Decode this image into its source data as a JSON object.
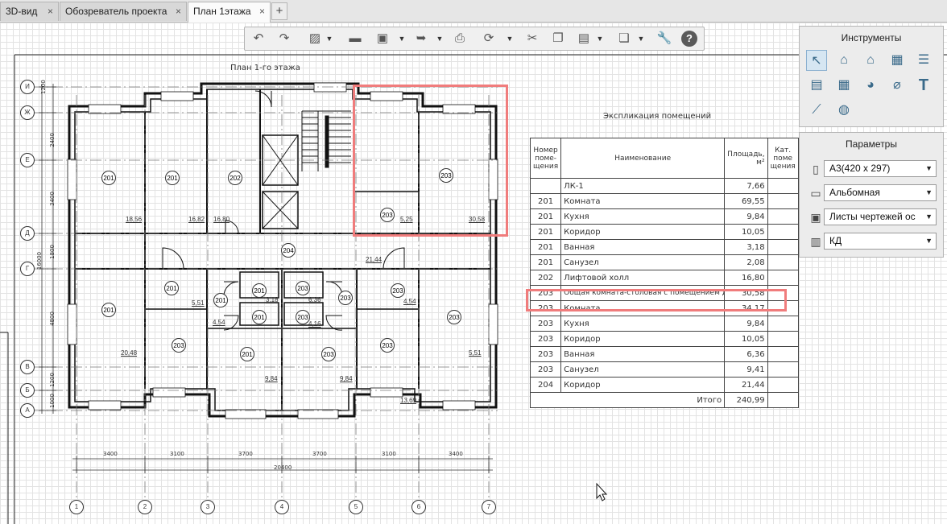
{
  "tabs": [
    {
      "label": "3D-вид",
      "close": "×"
    },
    {
      "label": "Обозреватель проекта",
      "close": "×"
    },
    {
      "label": "План 1этажа",
      "close": "×",
      "active": true
    }
  ],
  "tab_add": "+",
  "toolbar_icons": [
    "undo-icon",
    "redo-icon",
    "3d-box-icon",
    "open-folder-icon",
    "save-icon",
    "export-icon",
    "print-icon",
    "refresh-icon",
    "cut-icon",
    "copy-icon",
    "paste-icon",
    "layers-icon",
    "wrench-icon",
    "help-icon"
  ],
  "tools_panel": {
    "title": "Инструменты",
    "tools": [
      "cursor-icon",
      "building-icon",
      "house-icon",
      "sheet-icon",
      "list-icon",
      "room-schedule-icon",
      "table-icon",
      "shapes-icon",
      "dimension-icon",
      "text-icon",
      "line-icon",
      "hatch-icon"
    ],
    "text_tool_glyph": "T"
  },
  "params_panel": {
    "title": "Параметры",
    "rows": [
      {
        "icon": "paper-size-icon",
        "value": "А3(420 х 297)"
      },
      {
        "icon": "orientation-icon",
        "value": "Альбомная"
      },
      {
        "icon": "sheets-icon",
        "value": "Листы чертежей ос"
      },
      {
        "icon": "standard-icon",
        "value": "КД"
      }
    ],
    "dropdown_glyph": "▼"
  },
  "plan": {
    "title": "План 1-го этажа",
    "row_axes": [
      "И",
      "Ж",
      "Е",
      "Д",
      "Г",
      "В",
      "Б",
      "А"
    ],
    "row_dims": [
      "1200",
      "2400",
      "3400",
      "1800",
      "4800",
      "1200",
      "1000"
    ],
    "total_row_dim": "16000",
    "col_axes": [
      "1",
      "2",
      "3",
      "4",
      "5",
      "6",
      "7"
    ],
    "col_dims": [
      "3400",
      "3100",
      "3700",
      "3700",
      "3100",
      "3400"
    ],
    "total_col_dim": "20400",
    "rooms": [
      {
        "num": "201",
        "area": "18,56"
      },
      {
        "num": "201",
        "area": "16,82"
      },
      {
        "num": "202",
        "area": "16,80"
      },
      {
        "num": "203",
        "area": "5,25"
      },
      {
        "num": "203",
        "area": "30,58"
      },
      {
        "num": "204",
        "area": "21,44"
      },
      {
        "num": "201",
        "area": "20,48"
      },
      {
        "num": "201",
        "area": "5,51"
      },
      {
        "num": "201",
        "area": "4,54"
      },
      {
        "num": "201",
        "area": "3,18"
      },
      {
        "num": "201",
        "area": ""
      },
      {
        "num": "203",
        "area": "6,36"
      },
      {
        "num": "203",
        "area": "4,16"
      },
      {
        "num": "203",
        "area": ""
      },
      {
        "num": "203",
        "area": "4,54"
      },
      {
        "num": "203",
        "area": "5,51"
      },
      {
        "num": "203",
        "area": "20,48"
      },
      {
        "num": "201",
        "area": ""
      },
      {
        "num": "201",
        "area": "9,84"
      },
      {
        "num": "203",
        "area": "9,84"
      },
      {
        "num": "203",
        "area": "13,69"
      },
      {
        "num": "201",
        "area": ""
      }
    ]
  },
  "schedule": {
    "title": "Экспликация помещений",
    "headers": {
      "num": "Номер поме-щения",
      "name": "Наименование",
      "area": "Площадь, м²",
      "cat": "Кат. поме щения"
    },
    "rows": [
      {
        "num": "",
        "name": "ЛК-1",
        "area": "7,66"
      },
      {
        "num": "201",
        "name": "Комната",
        "area": "69,55"
      },
      {
        "num": "201",
        "name": "Кухня",
        "area": "9,84"
      },
      {
        "num": "201",
        "name": "Коридор",
        "area": "10,05"
      },
      {
        "num": "201",
        "name": "Ванная",
        "area": "3,18"
      },
      {
        "num": "201",
        "name": "Санузел",
        "area": "2,08"
      },
      {
        "num": "202",
        "name": "Лифтовой холл",
        "area": "16,80"
      },
      {
        "num": "203",
        "name": "Общая комната-столовая с помещением для приготовления пищи",
        "area": "30,58"
      },
      {
        "num": "203",
        "name": "Комната",
        "area": "34,17"
      },
      {
        "num": "203",
        "name": "Кухня",
        "area": "9,84"
      },
      {
        "num": "203",
        "name": "Коридор",
        "area": "10,05"
      },
      {
        "num": "203",
        "name": "Ванная",
        "area": "6,36"
      },
      {
        "num": "203",
        "name": "Санузел",
        "area": "9,41"
      },
      {
        "num": "204",
        "name": "Коридор",
        "area": "21,44"
      }
    ],
    "total_label": "Итого",
    "total_value": "240,99"
  },
  "highlight_color": "#f07c7c"
}
